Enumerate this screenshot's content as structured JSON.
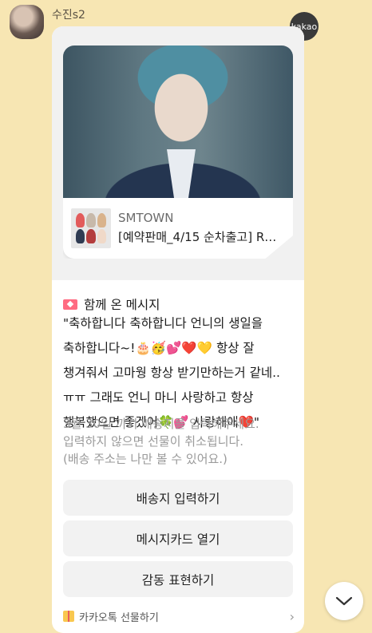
{
  "chat": {
    "sender_name": "수진s2",
    "kakao_badge": "kakao"
  },
  "gift_card": {
    "product": {
      "brand": "SMTOWN",
      "title": "[예약판매_4/15 순차출고] R…"
    },
    "message_heading": "함께 온 메시지",
    "message_line1": "\"축하합니다 축하합니다 언니의 생일을 축하합니다~!",
    "message_emojis1": "🎂🥳💕❤️💛",
    "message_line2": " 항상 잘 챙겨줘서 고마웡 항상 받기만하는거 같네..ㅠㅠ 그래도 언니 마니 사랑하고 항상 행복했으면 좋겠어",
    "message_emojis2": "🍀💕",
    "message_line3": " 사랑해애",
    "message_emojis3": "❤️",
    "message_end": "\"",
    "notice_line1": "3월 30일 까지 배송지를 입력해주세요.",
    "notice_line2": "입력하지 않으면 선물이 취소됩니다.",
    "notice_line3": "(배송 주소는 나만 볼 수 있어요.)",
    "buttons": {
      "enter_address": "배송지 입력하기",
      "open_message_card": "메시지카드 열기",
      "express_thanks": "감동 표현하기"
    },
    "footer_label": "카카오톡 선물하기"
  },
  "icons": {
    "envelope": "envelope-icon",
    "gift": "gift-icon",
    "chevron_right": "chevron-right-icon",
    "scroll_down": "chevron-down-icon"
  },
  "colors": {
    "background": "#f7e6b3",
    "button_bg": "#f2f2f2",
    "notice_text": "#9a9a9a"
  }
}
